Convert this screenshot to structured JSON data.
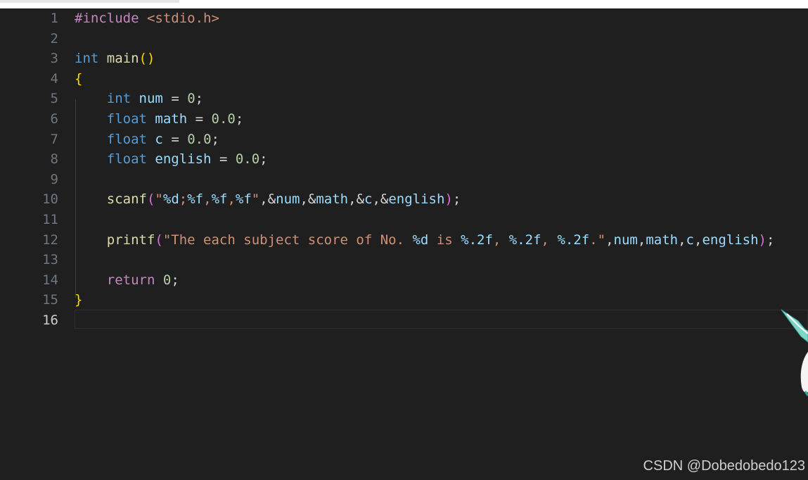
{
  "editor": {
    "active_line": 16,
    "lines": [
      {
        "no": "1",
        "tokens": [
          [
            "ctrl",
            "#include"
          ],
          [
            "pun",
            " "
          ],
          [
            "str",
            "<stdio.h>"
          ]
        ]
      },
      {
        "no": "2",
        "tokens": []
      },
      {
        "no": "3",
        "tokens": [
          [
            "kw",
            "int"
          ],
          [
            "pun",
            " "
          ],
          [
            "fn",
            "main"
          ],
          [
            "br1",
            "()"
          ]
        ]
      },
      {
        "no": "4",
        "tokens": [
          [
            "br1",
            "{"
          ]
        ]
      },
      {
        "no": "5",
        "tokens": [
          [
            "pun",
            "    "
          ],
          [
            "kw",
            "int"
          ],
          [
            "pun",
            " "
          ],
          [
            "var",
            "num"
          ],
          [
            "pun",
            " = "
          ],
          [
            "num",
            "0"
          ],
          [
            "pun",
            ";"
          ]
        ]
      },
      {
        "no": "6",
        "tokens": [
          [
            "pun",
            "    "
          ],
          [
            "kw",
            "float"
          ],
          [
            "pun",
            " "
          ],
          [
            "var",
            "math"
          ],
          [
            "pun",
            " = "
          ],
          [
            "num",
            "0.0"
          ],
          [
            "pun",
            ";"
          ]
        ]
      },
      {
        "no": "7",
        "tokens": [
          [
            "pun",
            "    "
          ],
          [
            "kw",
            "float"
          ],
          [
            "pun",
            " "
          ],
          [
            "var",
            "c"
          ],
          [
            "pun",
            " = "
          ],
          [
            "num",
            "0.0"
          ],
          [
            "pun",
            ";"
          ]
        ]
      },
      {
        "no": "8",
        "tokens": [
          [
            "pun",
            "    "
          ],
          [
            "kw",
            "float"
          ],
          [
            "pun",
            " "
          ],
          [
            "var",
            "english"
          ],
          [
            "pun",
            " = "
          ],
          [
            "num",
            "0.0"
          ],
          [
            "pun",
            ";"
          ]
        ]
      },
      {
        "no": "9",
        "tokens": []
      },
      {
        "no": "10",
        "tokens": [
          [
            "pun",
            "    "
          ],
          [
            "fn",
            "scanf"
          ],
          [
            "br2",
            "("
          ],
          [
            "str",
            "\""
          ],
          [
            "fmt",
            "%d"
          ],
          [
            "str",
            ";"
          ],
          [
            "fmt",
            "%f"
          ],
          [
            "str",
            ","
          ],
          [
            "fmt",
            "%f"
          ],
          [
            "str",
            ","
          ],
          [
            "fmt",
            "%f"
          ],
          [
            "str",
            "\""
          ],
          [
            "pun",
            ",&"
          ],
          [
            "var",
            "num"
          ],
          [
            "pun",
            ",&"
          ],
          [
            "var",
            "math"
          ],
          [
            "pun",
            ",&"
          ],
          [
            "var",
            "c"
          ],
          [
            "pun",
            ",&"
          ],
          [
            "var",
            "english"
          ],
          [
            "br2",
            ")"
          ],
          [
            "pun",
            ";"
          ]
        ]
      },
      {
        "no": "11",
        "tokens": []
      },
      {
        "no": "12",
        "tokens": [
          [
            "pun",
            "    "
          ],
          [
            "fn",
            "printf"
          ],
          [
            "br2",
            "("
          ],
          [
            "str",
            "\"The each subject score of No. "
          ],
          [
            "fmt",
            "%d"
          ],
          [
            "str",
            " is "
          ],
          [
            "fmt",
            "%.2f"
          ],
          [
            "str",
            ", "
          ],
          [
            "fmt",
            "%.2f"
          ],
          [
            "str",
            ", "
          ],
          [
            "fmt",
            "%.2f"
          ],
          [
            "str",
            ".\""
          ],
          [
            "pun",
            ","
          ],
          [
            "var",
            "num"
          ],
          [
            "pun",
            ","
          ],
          [
            "var",
            "math"
          ],
          [
            "pun",
            ","
          ],
          [
            "var",
            "c"
          ],
          [
            "pun",
            ","
          ],
          [
            "var",
            "english"
          ],
          [
            "br2",
            ")"
          ],
          [
            "pun",
            ";"
          ]
        ]
      },
      {
        "no": "13",
        "tokens": []
      },
      {
        "no": "14",
        "tokens": [
          [
            "pun",
            "    "
          ],
          [
            "ctrl",
            "return"
          ],
          [
            "pun",
            " "
          ],
          [
            "num",
            "0"
          ],
          [
            "pun",
            ";"
          ]
        ]
      },
      {
        "no": "15",
        "tokens": [
          [
            "br1",
            "}"
          ]
        ]
      },
      {
        "no": "16",
        "tokens": []
      }
    ]
  },
  "watermark": "CSDN @Dobedobedo123",
  "colors": {
    "background": "#1f1f1f",
    "keyword": "#569cd6",
    "control": "#c586c0",
    "function": "#dcdcaa",
    "variable": "#9cdcfe",
    "number": "#b5cea8",
    "string": "#ce9178",
    "bracket_level1": "#ffd700",
    "bracket_level2": "#da70d6"
  }
}
